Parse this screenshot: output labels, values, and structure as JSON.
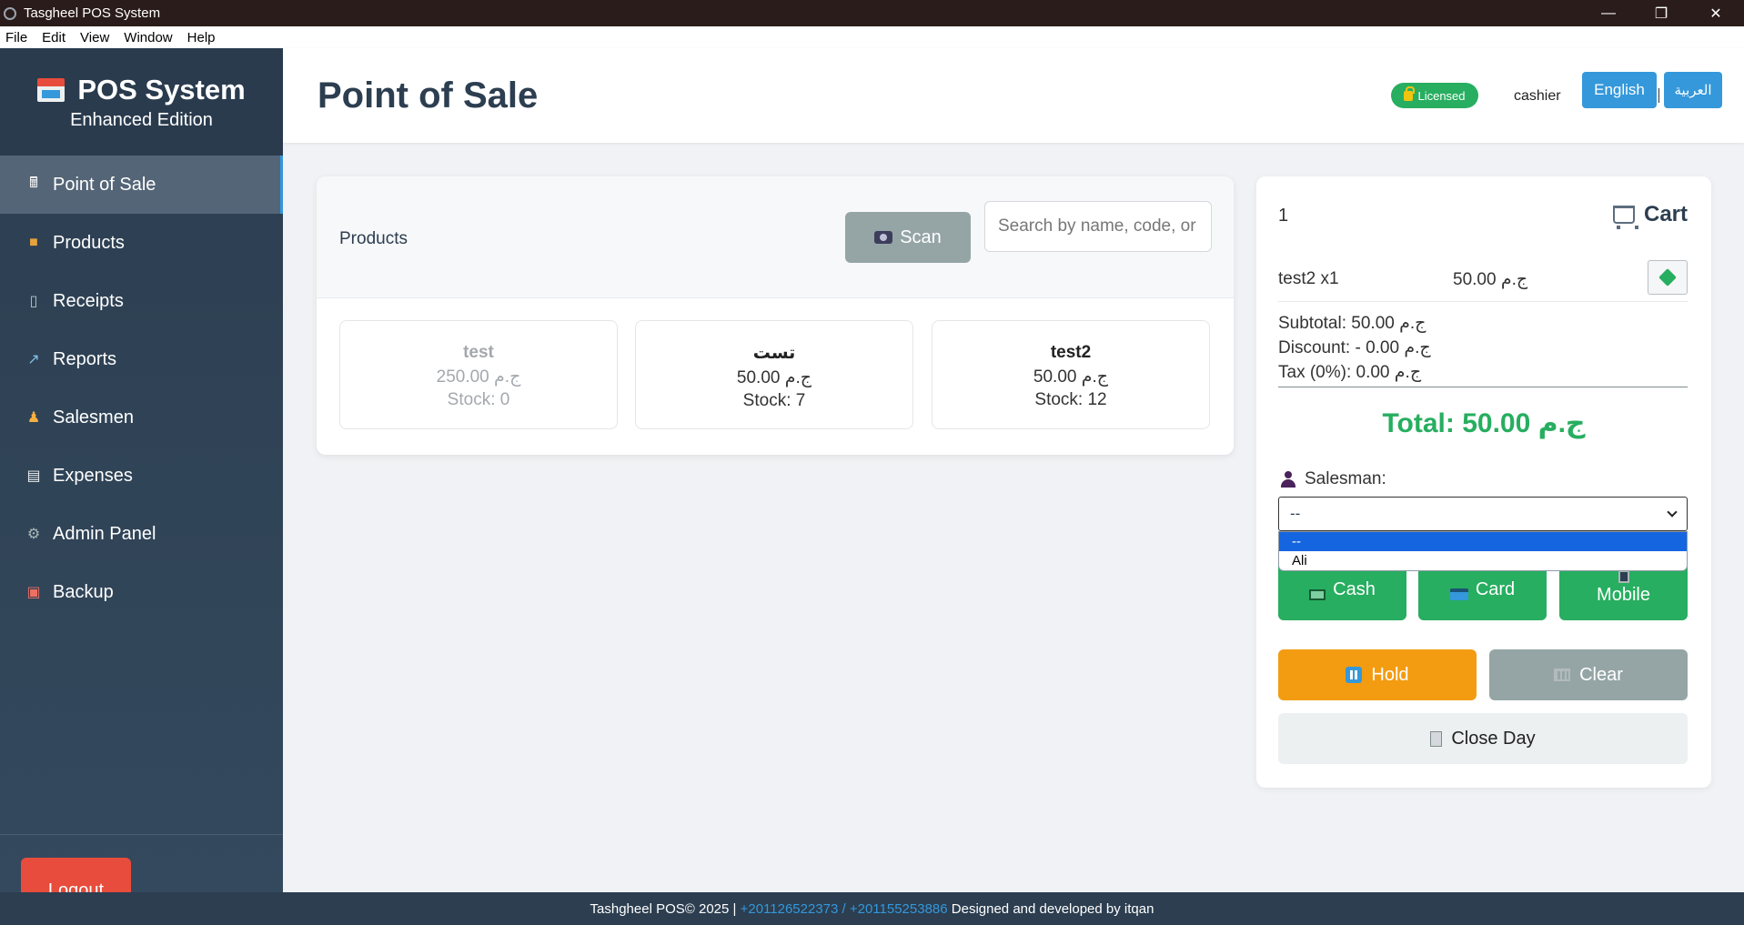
{
  "window": {
    "title": "Tasgheel POS System",
    "controls": {
      "minimize": "—",
      "restore": "❐",
      "close": "✕"
    }
  },
  "menu": [
    "File",
    "Edit",
    "View",
    "Window",
    "Help"
  ],
  "sidebar": {
    "brand_title": "POS System",
    "brand_subtitle": "Enhanced Edition",
    "items": [
      {
        "label": "Point of Sale",
        "icon": "register-icon",
        "active": true
      },
      {
        "label": "Products",
        "icon": "package-icon"
      },
      {
        "label": "Receipts",
        "icon": "receipt-icon"
      },
      {
        "label": "Reports",
        "icon": "chart-icon"
      },
      {
        "label": "Salesmen",
        "icon": "person-icon"
      },
      {
        "label": "Expenses",
        "icon": "clipboard-icon"
      },
      {
        "label": "Admin Panel",
        "icon": "gear-icon"
      },
      {
        "label": "Backup",
        "icon": "floppy-icon"
      }
    ],
    "logout_label": "Logout"
  },
  "header": {
    "title": "Point of Sale",
    "license_badge": "Licensed",
    "user": "cashier",
    "lang_english": "English",
    "lang_arabic": "العربية"
  },
  "products": {
    "label": "Products",
    "scan_label": "Scan",
    "search_placeholder": "Search by name, code, or barcode",
    "items": [
      {
        "name": "test",
        "price": "250.00 ج.م",
        "stock": "Stock: 0",
        "available": false
      },
      {
        "name": "تست",
        "price": "50.00 ج.م",
        "stock": "Stock: 7",
        "available": true
      },
      {
        "name": "test2",
        "price": "50.00 ج.م",
        "stock": "Stock: 12",
        "available": true
      }
    ]
  },
  "cart": {
    "count": "1",
    "title": "Cart",
    "items": [
      {
        "name": "test2 x1",
        "price": "50.00 ج.م"
      }
    ],
    "subtotal": "Subtotal: 50.00 ج.م",
    "discount": "Discount: - 0.00 ج.م",
    "tax": "Tax (0%): 0.00 ج.م",
    "total": "Total: 50.00 ج.م",
    "salesman_label": "Salesman:",
    "salesman_selected": "--",
    "salesman_options": [
      "--",
      "Ali"
    ],
    "pay_cash": "Cash",
    "pay_card": "Card",
    "pay_mobile": "Mobile",
    "hold_label": "Hold",
    "clear_label": "Clear",
    "close_day_label": "Close Day"
  },
  "footer": {
    "prefix": "Tashgheel POS© 2025 | ",
    "phones": "+201126522373 / +201155253886",
    "suffix": " Designed and developed by itqan"
  },
  "colors": {
    "accent": "#3498db",
    "success": "#27ae60",
    "danger": "#e74c3c",
    "warning": "#f39c12",
    "muted": "#95a5a6",
    "sidebar": "#2c3e50"
  }
}
